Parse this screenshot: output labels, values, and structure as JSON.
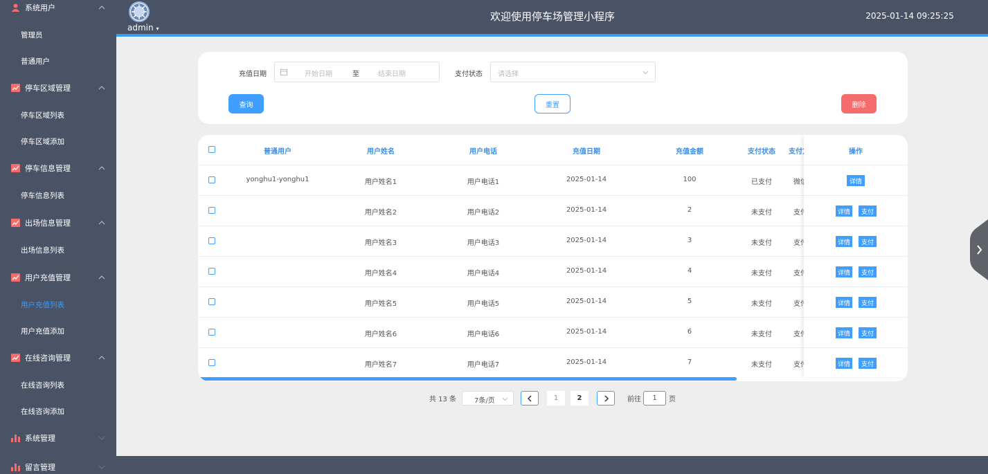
{
  "sidebar": {
    "groups": [
      {
        "label": "系统用户",
        "icon": "person-icon",
        "items": [
          {
            "label": "管理员"
          },
          {
            "label": "普通用户"
          }
        ]
      },
      {
        "label": "停车区域管理",
        "icon": "chart-icon",
        "items": [
          {
            "label": "停车区域列表"
          },
          {
            "label": "停车区域添加"
          }
        ]
      },
      {
        "label": "停车信息管理",
        "icon": "chart-icon",
        "items": [
          {
            "label": "停车信息列表"
          }
        ]
      },
      {
        "label": "出场信息管理",
        "icon": "chart-icon",
        "items": [
          {
            "label": "出场信息列表"
          }
        ]
      },
      {
        "label": "用户充值管理",
        "icon": "chart-icon",
        "items": [
          {
            "label": "用户充值列表",
            "active": true
          },
          {
            "label": "用户充值添加"
          }
        ]
      },
      {
        "label": "在线咨询管理",
        "icon": "chart-icon",
        "items": [
          {
            "label": "在线咨询列表"
          },
          {
            "label": "在线咨询添加"
          }
        ]
      },
      {
        "label": "系统管理",
        "icon": "bar-chart-icon",
        "items": []
      },
      {
        "label": "留言管理",
        "icon": "bar-chart-icon",
        "items": []
      }
    ]
  },
  "header": {
    "user": "admin",
    "title": "欢迎使用停车场管理小程序",
    "datetime": "2025-01-14 09:25:25"
  },
  "filter": {
    "date_label": "充值日期",
    "start_placeholder": "开始日期",
    "range_separator": "至",
    "end_placeholder": "结束日期",
    "status_label": "支付状态",
    "status_placeholder": "请选择",
    "query_label": "查询",
    "reset_label": "重置",
    "delete_label": "删除"
  },
  "table": {
    "headers": {
      "user": "普通用户",
      "name": "用户姓名",
      "phone": "用户电话",
      "date": "充值日期",
      "amount": "充值金额",
      "status": "支付状态",
      "method": "支付方",
      "actions": "操作"
    },
    "detail_label": "详情",
    "pay_label": "支付",
    "rows": [
      {
        "user": "yonghu1-yonghu1",
        "name": "用户姓名1",
        "phone": "用户电话1",
        "date": "2025-01-14",
        "amount": "100",
        "status": "已支付",
        "method": "微信",
        "can_pay": false
      },
      {
        "user": "",
        "name": "用户姓名2",
        "phone": "用户电话2",
        "date": "2025-01-14",
        "amount": "2",
        "status": "未支付",
        "method": "支付",
        "can_pay": true
      },
      {
        "user": "",
        "name": "用户姓名3",
        "phone": "用户电话3",
        "date": "2025-01-14",
        "amount": "3",
        "status": "未支付",
        "method": "支付",
        "can_pay": true
      },
      {
        "user": "",
        "name": "用户姓名4",
        "phone": "用户电话4",
        "date": "2025-01-14",
        "amount": "4",
        "status": "未支付",
        "method": "支付",
        "can_pay": true
      },
      {
        "user": "",
        "name": "用户姓名5",
        "phone": "用户电话5",
        "date": "2025-01-14",
        "amount": "5",
        "status": "未支付",
        "method": "支付",
        "can_pay": true
      },
      {
        "user": "",
        "name": "用户姓名6",
        "phone": "用户电话6",
        "date": "2025-01-14",
        "amount": "6",
        "status": "未支付",
        "method": "支付",
        "can_pay": true
      },
      {
        "user": "",
        "name": "用户姓名7",
        "phone": "用户电话7",
        "date": "2025-01-14",
        "amount": "7",
        "status": "未支付",
        "method": "支付",
        "can_pay": true
      }
    ]
  },
  "pagination": {
    "total_text": "共 13 条",
    "page_size": "7条/页",
    "pages": [
      "1",
      "2"
    ],
    "current": "1",
    "goto_label": "前往",
    "goto_value": "1",
    "page_unit": "页"
  },
  "colors": {
    "sidebar_bg": "#4a5366",
    "accent": "#409eff",
    "danger": "#f56c6c",
    "active_menu": "#3b9bf5"
  }
}
